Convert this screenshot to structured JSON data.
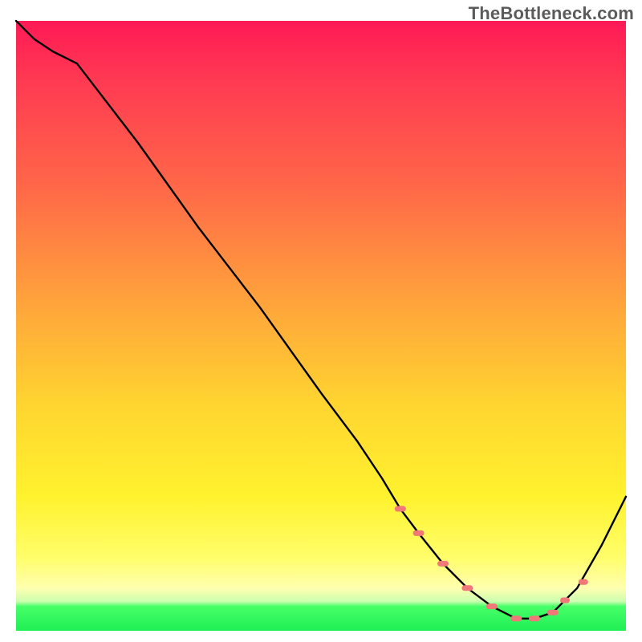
{
  "watermark": "TheBottleneck.com",
  "chart_data": {
    "type": "line",
    "title": "",
    "xlabel": "",
    "ylabel": "",
    "xlim": [
      0,
      100
    ],
    "ylim": [
      0,
      100
    ],
    "series": [
      {
        "name": "curve",
        "x": [
          0,
          3,
          6,
          10,
          20,
          30,
          40,
          50,
          56,
          60,
          63,
          66,
          70,
          74,
          78,
          82,
          85,
          88,
          92,
          96,
          100
        ],
        "y": [
          100,
          97,
          95,
          93,
          80,
          66,
          53,
          39,
          31,
          25,
          20,
          16,
          11,
          7,
          4,
          2,
          2,
          3,
          7,
          14,
          22
        ]
      }
    ],
    "flat_region": {
      "note": "dotted pink markers near valley bottom",
      "x": [
        63,
        66,
        70,
        74,
        78,
        82,
        85,
        88
      ],
      "y": [
        20,
        16,
        11,
        7,
        4,
        2,
        2,
        3
      ]
    },
    "colors": {
      "curve": "#000000",
      "markers": "#f07878",
      "gradient_top": "#ff1a56",
      "gradient_mid": "#ffd530",
      "gradient_bottom": "#1fef55"
    }
  }
}
